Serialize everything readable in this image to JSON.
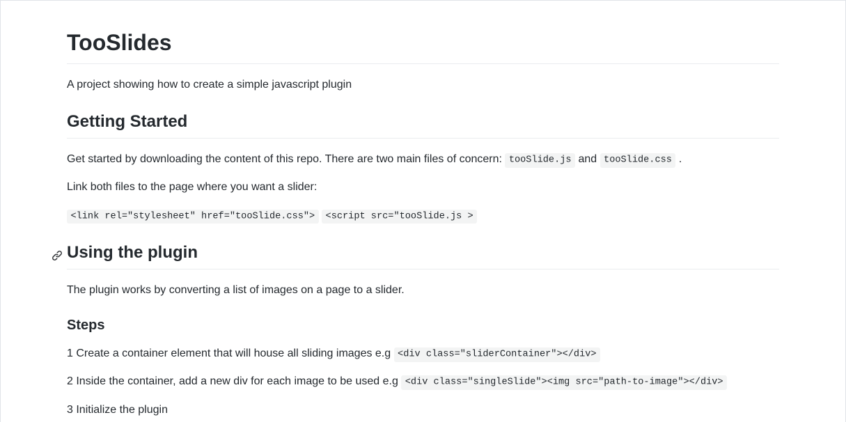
{
  "title": "TooSlides",
  "intro": "A project showing how to create a simple javascript plugin",
  "section_getting_started": {
    "heading": "Getting Started",
    "para1_prefix": "Get started by downloading the content of this repo. There are two main files of concern: ",
    "file_js": "tooSlide.js",
    "para1_mid": " and ",
    "file_css": "tooSlide.css",
    "para1_suffix": " .",
    "para2": "Link both files to the page where you want a slider:",
    "code_link": "<link rel=\"stylesheet\" href=\"tooSlide.css\">",
    "code_sep": " ",
    "code_script": "<script src=\"tooSlide.js >"
  },
  "section_using": {
    "heading": "Using the plugin",
    "para1": "The plugin works by converting a list of images on a page to a slider.",
    "steps_heading": "Steps",
    "step1_prefix": "1 Create a container element that will house all sliding images e.g ",
    "step1_code": "<div class=\"sliderContainer\"></div>",
    "step2_prefix": "2 Inside the container, add a new div for each image to be used e.g ",
    "step2_code": "<div class=\"singleSlide\"><img src=\"path-to-image\"></div>",
    "step3": "3 Initialize the plugin"
  }
}
